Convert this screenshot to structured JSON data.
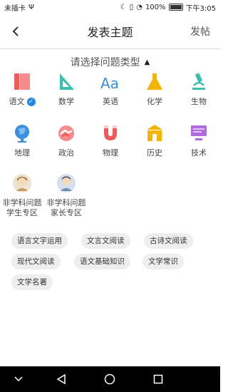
{
  "status_bar": {
    "carrier": "未插卡",
    "battery_pct": "100%",
    "time": "下午3:05"
  },
  "nav": {
    "title": "发表主题",
    "post_label": "发帖"
  },
  "type_prompt": "请选择问题类型",
  "subjects": [
    {
      "label": "语文",
      "icon": "book-icon",
      "color": "#f05a5a",
      "selected": true
    },
    {
      "label": "数学",
      "icon": "ruler-triangle-icon",
      "color": "#3bbfb0"
    },
    {
      "label": "英语",
      "icon": "aa-letters-icon",
      "color": "#3a8fe0"
    },
    {
      "label": "化学",
      "icon": "flask-icon",
      "color": "#f5b400"
    },
    {
      "label": "生物",
      "icon": "microscope-icon",
      "color": "#3bbfb0"
    },
    {
      "label": "地理",
      "icon": "globe-icon",
      "color": "#3a8fe0"
    },
    {
      "label": "政治",
      "icon": "handshake-icon",
      "color": "#f05a5a"
    },
    {
      "label": "物理",
      "icon": "magnet-icon",
      "color": "#f05a5a"
    },
    {
      "label": "历史",
      "icon": "gate-icon",
      "color": "#f5b400"
    },
    {
      "label": "技术",
      "icon": "monitor-icon",
      "color": "#b06bdc"
    },
    {
      "label_line1": "非学科问题",
      "label_line2": "学生专区",
      "icon": "student-avatar-icon",
      "color": "#d9c7a8"
    },
    {
      "label_line1": "非学科问题",
      "label_line2": "家长专区",
      "icon": "parent-avatar-icon",
      "color": "#a9bdd9"
    }
  ],
  "tags": [
    "语言文字运用",
    "文言文阅读",
    "古诗文阅读",
    "现代文阅读",
    "语文基础知识",
    "文学常识",
    "文学名著"
  ]
}
